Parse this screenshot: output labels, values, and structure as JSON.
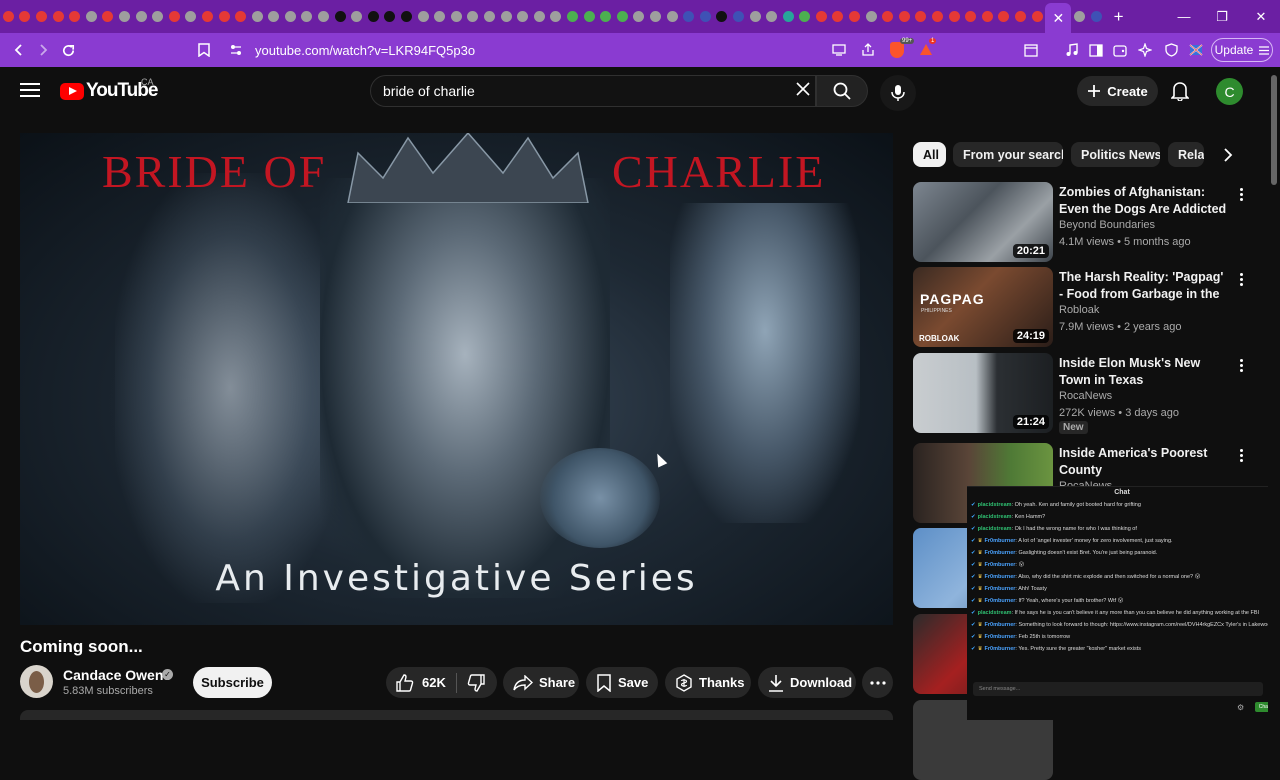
{
  "browser": {
    "tab_count_shown": 65,
    "active_tab_close": "✕",
    "new_tab": "+",
    "url": "youtube.com/watch?v=LKR94FQ5p3o",
    "update_label": "Update",
    "shield_badge": "99+",
    "alert_badge": "1",
    "colors": {
      "tabstrip": "#6b1fa3",
      "toolbar": "#8a3bd1"
    }
  },
  "header": {
    "logo_text": "YouTube",
    "country_code": "CA",
    "search_value": "bride of charlie",
    "create_label": "Create",
    "avatar_letter": "C"
  },
  "video": {
    "thumbnail_title_left": "BRIDE OF",
    "thumbnail_title_right": "CHARLIE",
    "thumbnail_subtitle": "An Investigative Series",
    "title": "Coming soon...",
    "channel": "Candace Owens",
    "subscribers": "5.83M subscribers",
    "subscribe_label": "Subscribe",
    "likes": "62K",
    "share_label": "Share",
    "save_label": "Save",
    "thanks_label": "Thanks",
    "download_label": "Download"
  },
  "chips": [
    "All",
    "From your search",
    "Politics News",
    "Rela"
  ],
  "recommendations": [
    {
      "title": "Zombies of Afghanistan: Even the Dogs Are Addicted (Never ...",
      "channel": "Beyond Boundaries",
      "meta": "4.1M views • 5 months ago",
      "duration": "20:21",
      "badge": ""
    },
    {
      "title": "The Harsh Reality: 'Pagpag' - Food from Garbage in the ...",
      "channel": "Robloak",
      "meta": "7.9M views • 2 years ago",
      "duration": "24:19",
      "badge": "",
      "thumb_text": "PAGPAG",
      "thumb_sub": "PHILIPPINES",
      "thumb_brand": "ROBLOAK"
    },
    {
      "title": "Inside Elon Musk's New Town in Texas",
      "channel": "RocaNews",
      "meta": "272K views • 3 days ago",
      "duration": "21:24",
      "badge": "New"
    },
    {
      "title": "Inside America's Poorest County",
      "channel": "RocaNews",
      "meta": "",
      "duration": "",
      "badge": ""
    }
  ],
  "chat": {
    "title": "Chat",
    "input_placeholder": "Send message...",
    "send_label": "Chat",
    "messages": [
      {
        "user": "placidstream",
        "text": "Oh yeah. Ken and family got booted hard for grifting",
        "style": "u1"
      },
      {
        "user": "placidstream",
        "text": "Ken Hamm?",
        "style": "u1"
      },
      {
        "user": "placidstream",
        "text": "Ok I had the wrong name for who I was thinking of",
        "style": "u1"
      },
      {
        "user": "Fr0mburner",
        "text": "A lot of 'angel invester' money for zero involvement, just saying.",
        "style": "u2"
      },
      {
        "user": "Fr0mburner",
        "text": "Gaslighting doesn't exist Bret. You're just being paranoid.",
        "style": "u2"
      },
      {
        "user": "Fr0mburner",
        "text": "😮",
        "style": "u2"
      },
      {
        "user": "Fr0mburner",
        "text": "Also, why did the shirt mic explode and then switched for a normal one? 😮",
        "style": "u2"
      },
      {
        "user": "Fr0mburner",
        "text": "Ahh! Toasty",
        "style": "u2"
      },
      {
        "user": "Fr0mburner",
        "text": "If? Yeah, where's your faith brother? Wtf 😮",
        "style": "u2"
      },
      {
        "user": "placidstream",
        "text": "If he says he is you can't believe it any more than you can believe he did anything working at the FBI",
        "style": "u1"
      },
      {
        "user": "Fr0mburner",
        "text": "Something to look forward to though: https://www.instagram.com/reel/DVH4rkgEZCx Tyler's in Lakewood NJ",
        "style": "u2"
      },
      {
        "user": "Fr0mburner",
        "text": "Feb 25th is tomorrow",
        "style": "u2"
      },
      {
        "user": "Fr0mburner",
        "text": "Yes. Pretty sure the greater \"kosher\" market exists",
        "style": "u2"
      }
    ]
  }
}
